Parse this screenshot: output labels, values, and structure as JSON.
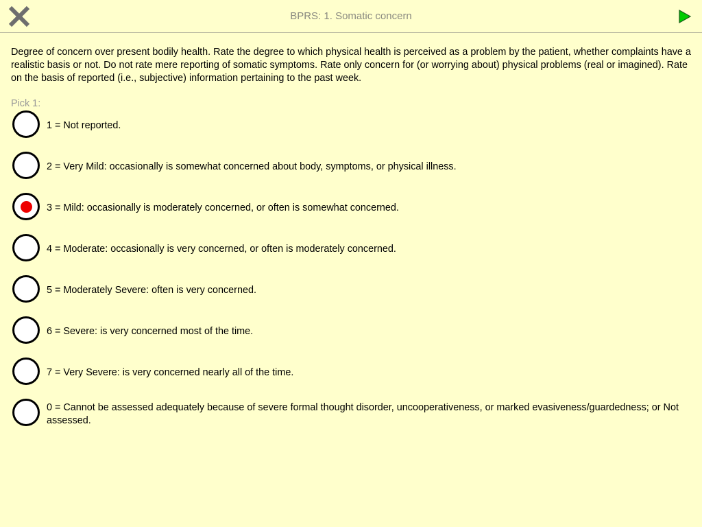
{
  "header": {
    "title": "BPRS: 1. Somatic concern",
    "close_icon": "close-x-icon",
    "next_icon": "play-arrow-icon",
    "next_color": "#00cc00"
  },
  "description": "Degree of concern over present bodily health. Rate the degree to which physical health is perceived as a problem by the patient, whether complaints have a realistic basis or not. Do not rate mere reporting of somatic symptoms. Rate only concern for (or worrying about) physical problems (real or imagined). Rate on the basis of reported (i.e., subjective) information pertaining to the past week.",
  "pick_label": "Pick 1:",
  "selected_index": 2,
  "selected_color": "#ee0000",
  "options": [
    {
      "label": "1 = Not reported."
    },
    {
      "label": "2 = Very Mild: occasionally is somewhat concerned about body, symptoms, or physical illness."
    },
    {
      "label": "3 = Mild: occasionally is moderately concerned, or often is somewhat concerned."
    },
    {
      "label": "4 = Moderate: occasionally is very concerned, or often is moderately concerned."
    },
    {
      "label": "5 = Moderately Severe: often is very concerned."
    },
    {
      "label": "6 = Severe: is very concerned most of the time."
    },
    {
      "label": "7 = Very Severe: is very concerned nearly all of the time."
    },
    {
      "label": "0 = Cannot be assessed adequately because of severe formal thought disorder, uncooperativeness, or marked evasiveness/guardedness; or Not assessed."
    }
  ]
}
